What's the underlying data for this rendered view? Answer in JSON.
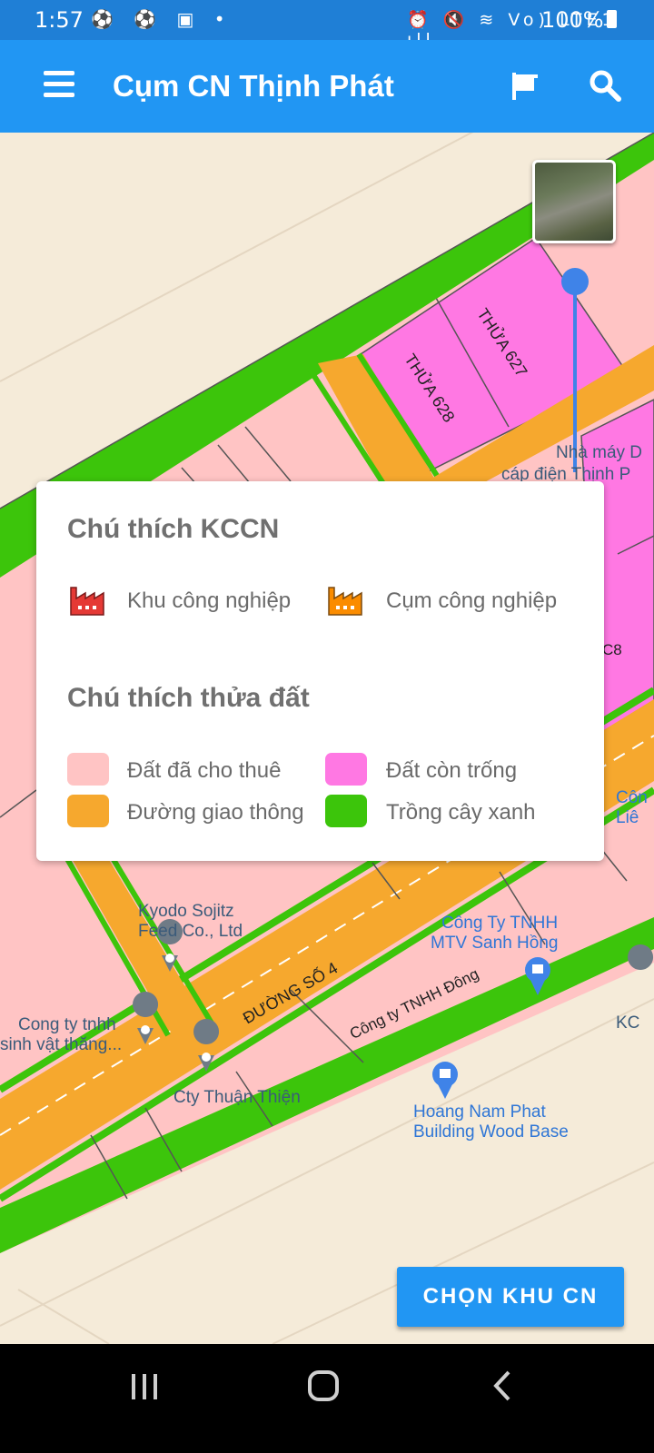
{
  "status_bar": {
    "time": "1:57",
    "left_icons": "⚽ ⚽ ▣ •",
    "right_icons": "⏰ 🔇 ≋ Vo) LTE1 ıll",
    "battery": "100%"
  },
  "app_bar": {
    "title": "Cụm CN Thịnh Phát",
    "menu_icon": "hamburger-menu-icon",
    "flag_icon": "flag-icon",
    "search_icon": "search-icon"
  },
  "map": {
    "parcel_labels": [
      "THỬA 627",
      "THỬA 628"
    ],
    "road_label": "ĐƯỜNG SỐ 4",
    "places": {
      "nha_may_line1": "Nhà máy D",
      "nha_may_line2": "cáp điện Thịnh P",
      "kyodo_line1": "Kyodo Sojitz",
      "kyodo_line2": "Feed Co., Ltd",
      "sanh_hong_line1": "Công Ty TNHH",
      "sanh_hong_line2": "MTV Sanh Hồng",
      "dong_label": "Công ty TNHH Đông",
      "sinh_vat_line1": "Cong ty tnhh",
      "sinh_vat_line2": "sinh vật thăng...",
      "thuan_thien": "Cty Thuận Thiện",
      "hoang_nam_line1": "Hoang Nam Phat",
      "hoang_nam_line2": "Building Wood Base",
      "edge_c8": "C8",
      "edge_con_line1": "Côn",
      "edge_con_line2": "Liê",
      "edge_kc": "KC"
    },
    "colors": {
      "background": "#f5ebd9",
      "leased": "#ffc4c4",
      "vacant": "#ff78e3",
      "road": "#f6a82e",
      "green": "#3cc50b"
    }
  },
  "legend": {
    "kccn_title": "Chú thích KCCN",
    "industrial_zone": "Khu công nghiệp",
    "industrial_cluster": "Cụm công nghiệp",
    "parcel_title": "Chú thích thửa đất",
    "items": [
      {
        "label": "Đất đã cho thuê",
        "color": "#ffc4c4"
      },
      {
        "label": "Đất còn trống",
        "color": "#ff78e3"
      },
      {
        "label": "Đường giao thông",
        "color": "#f6a82e"
      },
      {
        "label": "Trồng cây xanh",
        "color": "#3cc50b"
      }
    ]
  },
  "choose_button": "CHỌN KHU CN",
  "nav_bar": {
    "recent_icon": "recent-apps-icon",
    "home_icon": "home-icon",
    "back_icon": "back-icon"
  }
}
